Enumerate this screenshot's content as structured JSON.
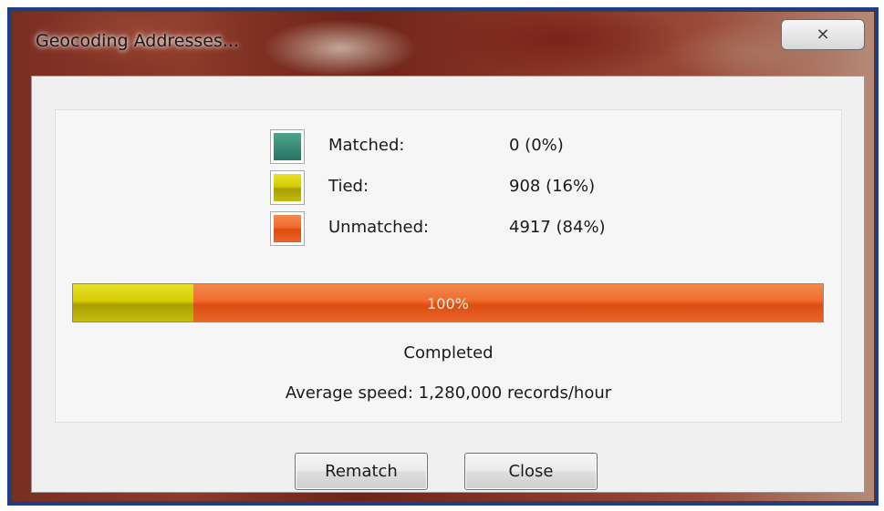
{
  "window": {
    "title": "Geocoding Addresses...",
    "close_icon": "close-icon"
  },
  "legend": [
    {
      "label": "Matched:",
      "value": "0 (0%)",
      "color": "#3b8c76"
    },
    {
      "label": "Tied:",
      "value": "908 (16%)",
      "color": "#d6cc04"
    },
    {
      "label": "Unmatched:",
      "value": "4917 (84%)",
      "color": "#ef6a2c"
    }
  ],
  "progress": {
    "text": "100%",
    "tied_fraction": 0.16,
    "unmatched_fraction": 0.84
  },
  "status": "Completed",
  "speed": "Average speed: 1,280,000 records/hour",
  "buttons": {
    "rematch": "Rematch",
    "close": "Close"
  }
}
